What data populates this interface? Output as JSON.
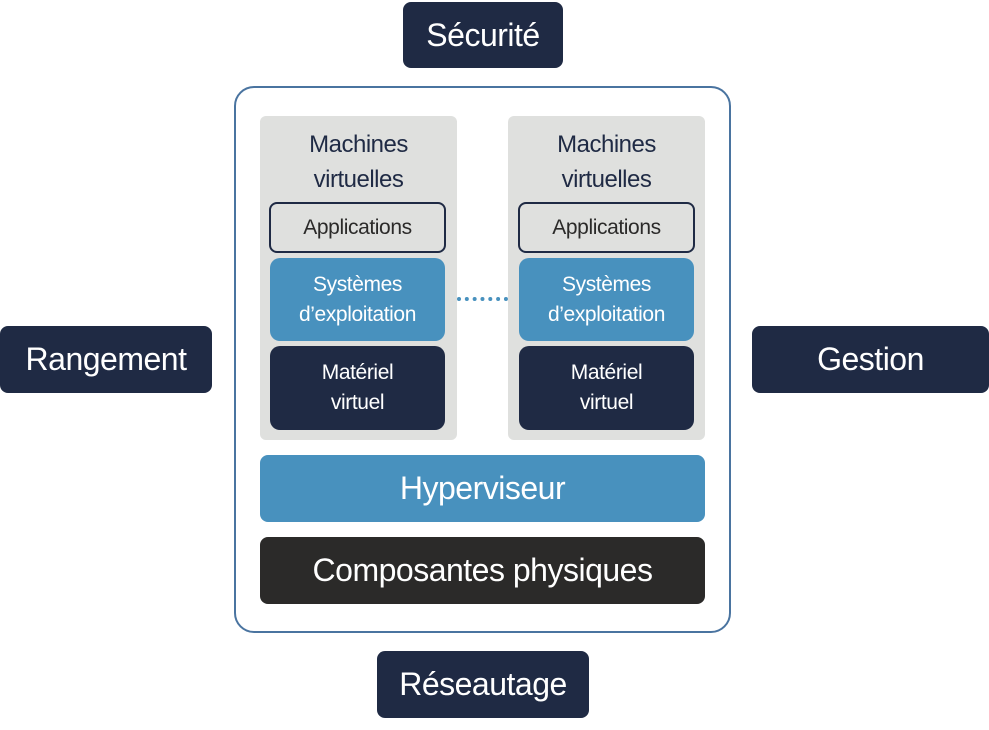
{
  "top_label": "Sécurité",
  "bottom_label": "Réseautage",
  "left_label": "Rangement",
  "right_label": "Gestion",
  "virtual_machines": [
    {
      "title_line1": "Machines",
      "title_line2": "virtuelles",
      "applications": "Applications",
      "os_line1": "Systèmes",
      "os_line2": "d’exploitation",
      "hw_line1": "Matériel",
      "hw_line2": "virtuel"
    },
    {
      "title_line1": "Machines",
      "title_line2": "virtuelles",
      "applications": "Applications",
      "os_line1": "Systèmes",
      "os_line2": "d’exploitation",
      "hw_line1": "Matériel",
      "hw_line2": "virtuel"
    }
  ],
  "hypervisor": "Hyperviseur",
  "physical": "Composantes physiques",
  "colors": {
    "navy": "#1f2a44",
    "blue": "#4891be",
    "gray": "#dfe0de",
    "dark": "#2b2a29",
    "border": "#4a74a0"
  }
}
